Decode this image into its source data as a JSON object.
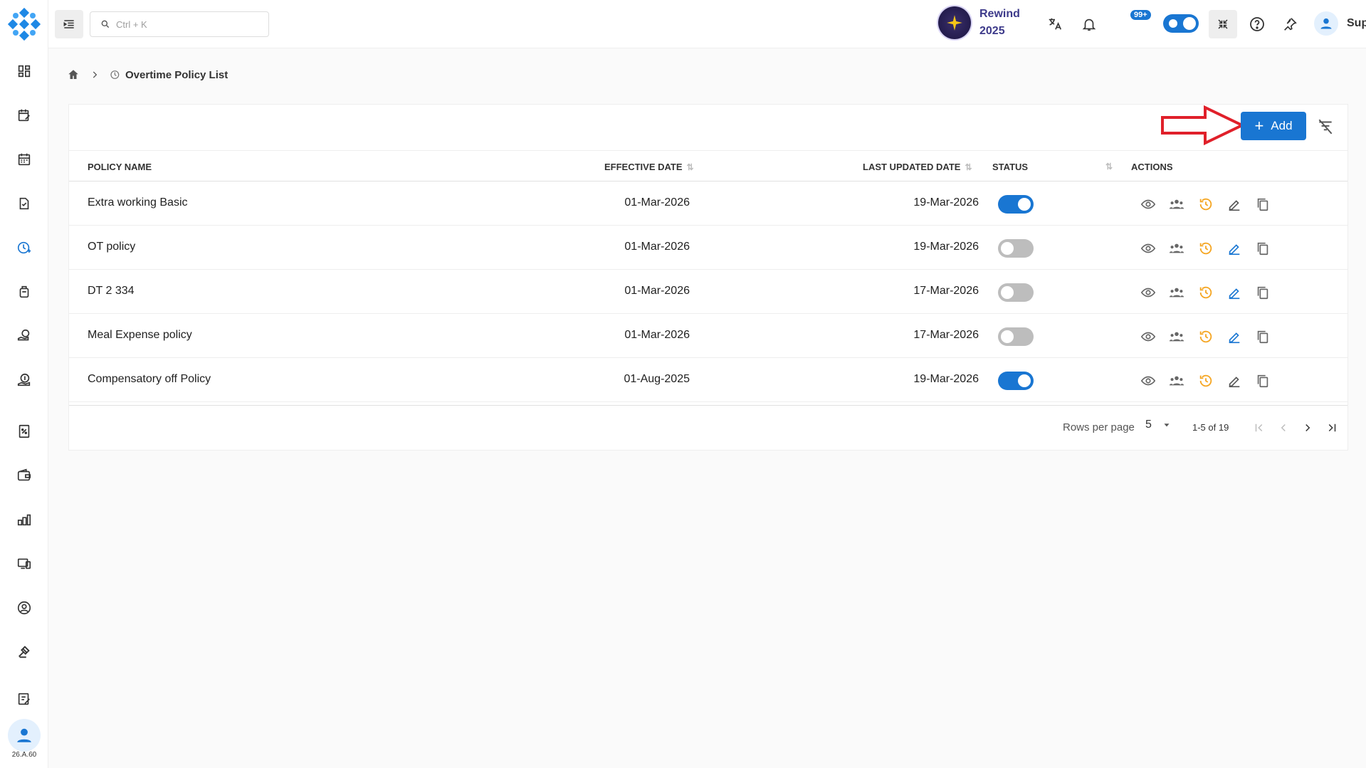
{
  "app": {
    "version": "26.A.60"
  },
  "header": {
    "search_placeholder": "Ctrl + K",
    "rewind": {
      "line1": "Rewind",
      "line2": "2025"
    },
    "notification_badge": "99+",
    "user_name": "Support"
  },
  "breadcrumb": {
    "current": "Overtime Policy List"
  },
  "toolbar": {
    "add_label": "Add"
  },
  "table": {
    "columns": {
      "policy_name": "POLICY NAME",
      "effective_date": "EFFECTIVE DATE",
      "last_updated_date": "LAST UPDATED DATE",
      "status": "STATUS",
      "actions": "ACTIONS"
    },
    "rows": [
      {
        "policy_name": "Extra working Basic",
        "effective_date": "01-Mar-2026",
        "last_updated_date": "19-Mar-2026",
        "status": "on"
      },
      {
        "policy_name": "OT policy",
        "effective_date": "01-Mar-2026",
        "last_updated_date": "19-Mar-2026",
        "status": "off"
      },
      {
        "policy_name": "DT 2 334",
        "effective_date": "01-Mar-2026",
        "last_updated_date": "17-Mar-2026",
        "status": "off"
      },
      {
        "policy_name": "Meal Expense policy",
        "effective_date": "01-Mar-2026",
        "last_updated_date": "17-Mar-2026",
        "status": "off"
      },
      {
        "policy_name": "Compensatory off Policy",
        "effective_date": "01-Aug-2025",
        "last_updated_date": "19-Mar-2026",
        "status": "on"
      }
    ]
  },
  "pagination": {
    "rows_per_page_label": "Rows per page",
    "rows_per_page": "5",
    "range": "1-5 of 19"
  },
  "colors": {
    "primary": "#1976d2",
    "accent_orange": "#f5a623",
    "arrow_red": "#e0202a"
  }
}
